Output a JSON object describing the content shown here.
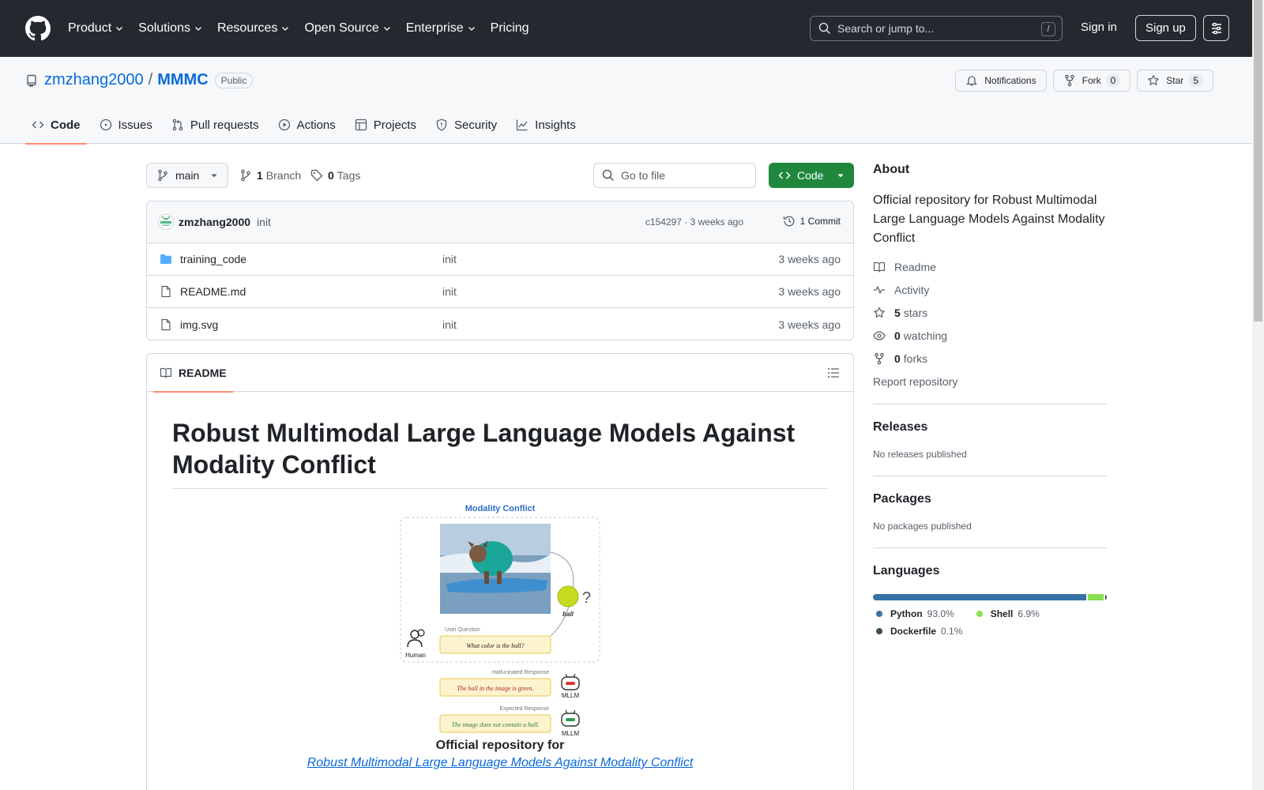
{
  "header": {
    "nav": [
      "Product",
      "Solutions",
      "Resources",
      "Open Source",
      "Enterprise",
      "Pricing"
    ],
    "search_placeholder": "Search or jump to...",
    "search_shortcut": "/",
    "sign_in": "Sign in",
    "sign_up": "Sign up"
  },
  "repo": {
    "owner": "zmzhang2000",
    "separator": "/",
    "name": "MMMC",
    "visibility": "Public",
    "notifications_label": "Notifications",
    "fork_label": "Fork",
    "fork_count": "0",
    "star_label": "Star",
    "star_count": "5"
  },
  "tabs": [
    "Code",
    "Issues",
    "Pull requests",
    "Actions",
    "Projects",
    "Security",
    "Insights"
  ],
  "toolbar": {
    "branch": "main",
    "branch_count": "1",
    "branch_label": "Branch",
    "tag_count": "0",
    "tag_label": "Tags",
    "go_to_file": "Go to file",
    "code_button": "Code"
  },
  "commit": {
    "author": "zmzhang2000",
    "message": "init",
    "meta": "c154297 · 3 weeks ago",
    "count_label": "1 Commit"
  },
  "files": [
    {
      "name": "training_code",
      "type": "folder",
      "message": "init",
      "date": "3 weeks ago"
    },
    {
      "name": "README.md",
      "type": "file",
      "message": "init",
      "date": "3 weeks ago"
    },
    {
      "name": "img.svg",
      "type": "file",
      "message": "init",
      "date": "3 weeks ago"
    }
  ],
  "readme": {
    "tab_label": "README",
    "title": "Robust Multimodal Large Language Models Against Modality Conflict",
    "figure": {
      "title": "Modality Conflict",
      "object_label": "ball",
      "question_label": "User Question",
      "question": "What color is the ball?",
      "human_label": "Human",
      "hallucinated_label": "Hallucinated Response",
      "hallucinated": "The ball in the image is green.",
      "expected_label": "Expected Response",
      "expected": "The image does not contain a ball.",
      "model_label": "MLLM"
    },
    "caption": "Official repository for",
    "caption_link": "Robust Multimodal Large Language Models Against Modality Conflict"
  },
  "sidebar": {
    "about_heading": "About",
    "description": "Official repository for Robust Multimodal Large Language Models Against Modality Conflict",
    "readme_link": "Readme",
    "activity_link": "Activity",
    "stars_count": "5",
    "stars_label": "stars",
    "watching_count": "0",
    "watching_label": "watching",
    "forks_count": "0",
    "forks_label": "forks",
    "report_link": "Report repository",
    "releases_heading": "Releases",
    "releases_note": "No releases published",
    "packages_heading": "Packages",
    "packages_note": "No packages published",
    "languages_heading": "Languages",
    "languages": [
      {
        "name": "Python",
        "percent": "93.0%",
        "value": 93.0,
        "color": "#3572A5"
      },
      {
        "name": "Shell",
        "percent": "6.9%",
        "value": 6.9,
        "color": "#89e051"
      },
      {
        "name": "Dockerfile",
        "percent": "0.1%",
        "value": 0.1,
        "color": "#384d54"
      }
    ]
  },
  "colors": {
    "header_bg": "#24292f",
    "link": "#0969da",
    "primary_button": "#1f883d",
    "tab_underline": "#fd8c73"
  }
}
